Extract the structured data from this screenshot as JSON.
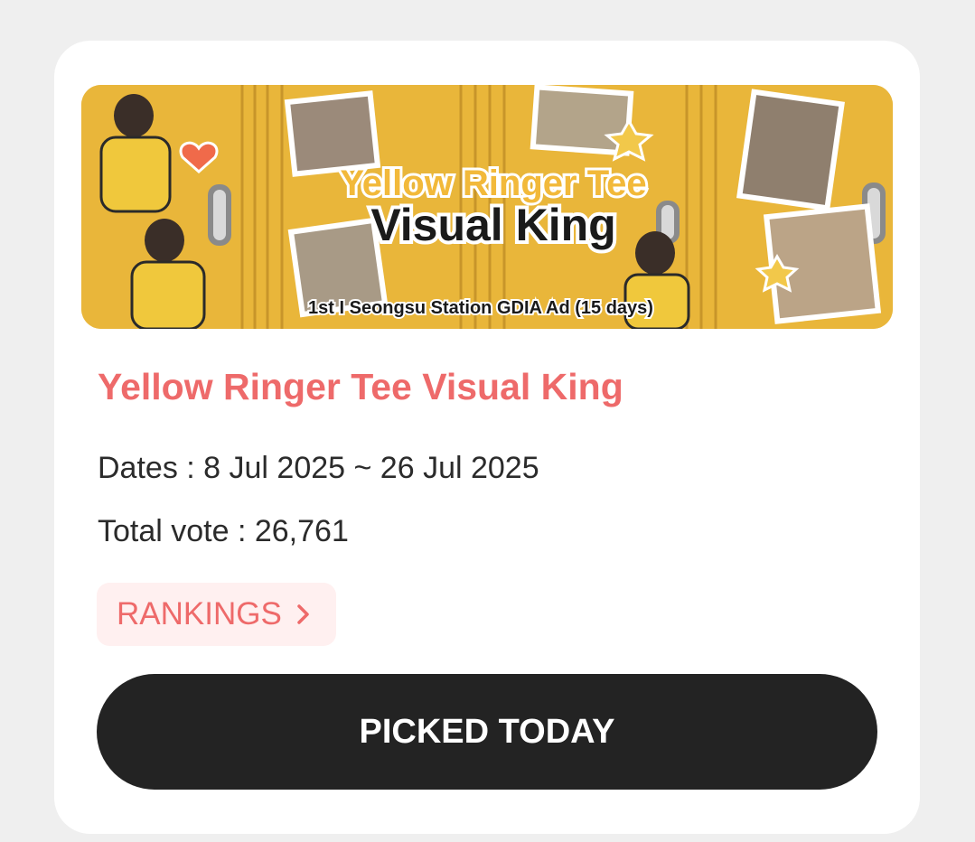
{
  "card": {
    "banner": {
      "headline_line1": "Yellow Ringer Tee",
      "headline_line2": "Visual King",
      "footer_text": "1st I Seongsu Station GDIA Ad (15 days)",
      "colors": {
        "locker": "#e9b63a",
        "locker_dark": "#c8952a",
        "headline_fill": "#f2b93a",
        "outline": "#ffffff"
      }
    },
    "title": "Yellow Ringer Tee Visual King",
    "dates": "Dates : 8 Jul 2025 ~ 26 Jul 2025",
    "total_vote": "Total vote : 26,761",
    "rankings_label": "RANKINGS",
    "rankings_icon": "chevron-right-icon",
    "action_label": "PICKED TODAY"
  },
  "colors": {
    "accent": "#ee6a6a",
    "rankings_bg": "#fff0f0",
    "button_bg": "#232323",
    "page_bg": "#efefef"
  }
}
